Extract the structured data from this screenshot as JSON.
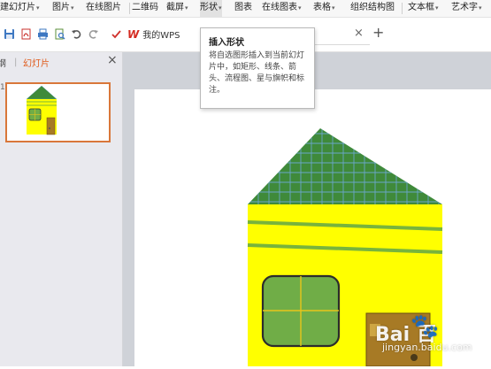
{
  "menubar": {
    "items": [
      {
        "label": "建幻灯片",
        "caret": true
      },
      {
        "label": "图片",
        "caret": true
      },
      {
        "label": "在线图片",
        "caret": false
      },
      {
        "label": "二维码",
        "caret": false
      },
      {
        "label": "截屏",
        "caret": true
      },
      {
        "label": "形状",
        "caret": true
      },
      {
        "label": "图表",
        "caret": false
      },
      {
        "label": "在线图表",
        "caret": true
      },
      {
        "label": "表格",
        "caret": true
      },
      {
        "label": "组织结构图",
        "caret": false
      },
      {
        "label": "文本框",
        "caret": true
      },
      {
        "label": "艺术字",
        "caret": true
      }
    ],
    "caret_glyph": "▾"
  },
  "toolbar": {
    "wps_logo": "W",
    "wps_tab_label": "我的WPS",
    "tab_close": "×",
    "tab_add": "+"
  },
  "slide_pane": {
    "tab_outline": "纲",
    "tab_slides": "幻灯片",
    "close": "×",
    "slide_number": "1"
  },
  "tooltip": {
    "title": "插入形状",
    "body": "将自选图形插入到当前幻灯片中，如矩形、线条、箭头、流程图、星与旗帜和标注。"
  },
  "watermark": {
    "brand": "Bai  百",
    "paw": "🐾",
    "sub": "jingyan.baidu.com"
  },
  "colors": {
    "roof": "#3f8a3a",
    "roof_grid": "#6aa6c8",
    "wall": "#ffff00",
    "stripe": "#78b43c",
    "window": "#70ad47",
    "window_cross": "#e8c51a",
    "door": "#a77a25",
    "accent_orange": "#e05a1a"
  }
}
